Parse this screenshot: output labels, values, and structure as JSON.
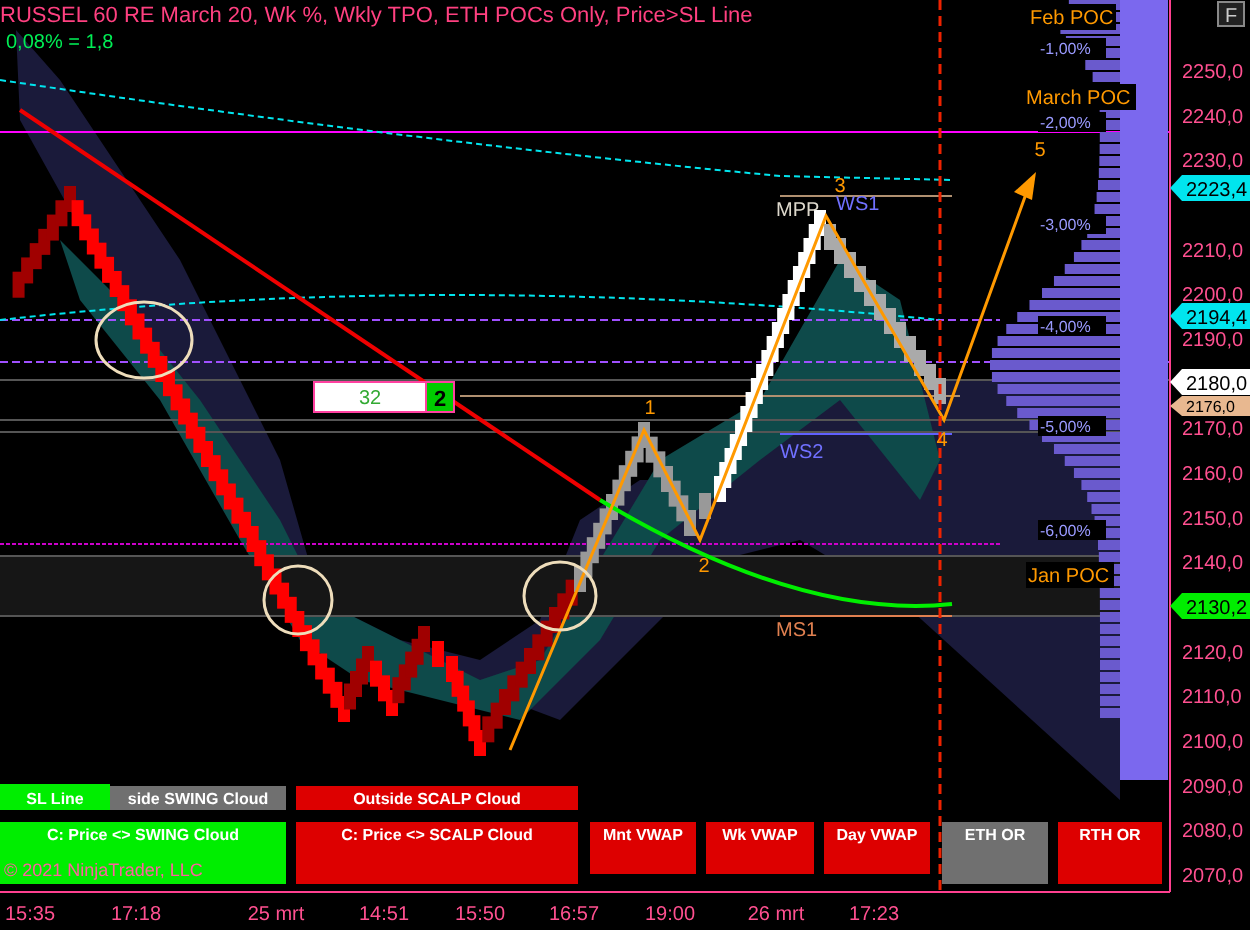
{
  "title": "RUSSEL 60 RE March 20, Wk %, Wkly TPO, ETH POCs Only, Price>SL Line",
  "subtitle": "0,08% = 1,8",
  "corner_button": "F",
  "price_axis": [
    "2250,0",
    "2240,0",
    "2230,0",
    "2210,0",
    "2200,0",
    "2190,0",
    "2170,0",
    "2160,0",
    "2150,0",
    "2140,0",
    "2120,0",
    "2110,0",
    "2100,0",
    "2090,0",
    "2080,0",
    "2070,0"
  ],
  "price_tags": [
    {
      "label": "2223,4",
      "color": "#00e5ee"
    },
    {
      "label": "2194,4",
      "color": "#00e5ee"
    },
    {
      "label": "2180,0",
      "color": "#ffffff"
    },
    {
      "label": "2176,0",
      "color": "#e8b890"
    },
    {
      "label": "2130,2",
      "color": "#00ee00"
    }
  ],
  "time_axis": [
    "15:35",
    "17:18",
    "25 mrt",
    "14:51",
    "15:50",
    "16:57",
    "19:00",
    "26 mrt",
    "17:23"
  ],
  "poc_labels": [
    "Feb POC",
    "March POC",
    "Jan POC"
  ],
  "pivot_labels": [
    "MPP",
    "WS1",
    "WS2",
    "MS1"
  ],
  "wave_labels": [
    "1",
    "2",
    "3",
    "4",
    "5"
  ],
  "percent_labels": [
    "-1,00%",
    "-2,00%",
    "-3,00%",
    "-4,00%",
    "-5,00%",
    "-6,00%"
  ],
  "counter": {
    "value": "32",
    "badge": "2"
  },
  "buttons": [
    {
      "label": "SL Line",
      "color": "#00ee00"
    },
    {
      "label": "side SWING Cloud",
      "color": "#707070"
    },
    {
      "label": "Outside SCALP Cloud",
      "color": "#dd0000"
    },
    {
      "label": "C: Price <> SWING Cloud",
      "color": "#00ee00"
    },
    {
      "label": "C: Price <> SCALP Cloud",
      "color": "#dd0000"
    },
    {
      "label": "Mnt VWAP",
      "color": "#dd0000"
    },
    {
      "label": "Wk VWAP",
      "color": "#dd0000"
    },
    {
      "label": "Day VWAP",
      "color": "#dd0000"
    },
    {
      "label": "ETH OR",
      "color": "#707070"
    },
    {
      "label": "RTH OR",
      "color": "#dd0000"
    }
  ],
  "copyright": "© 2021 NinjaTrader, LLC"
}
